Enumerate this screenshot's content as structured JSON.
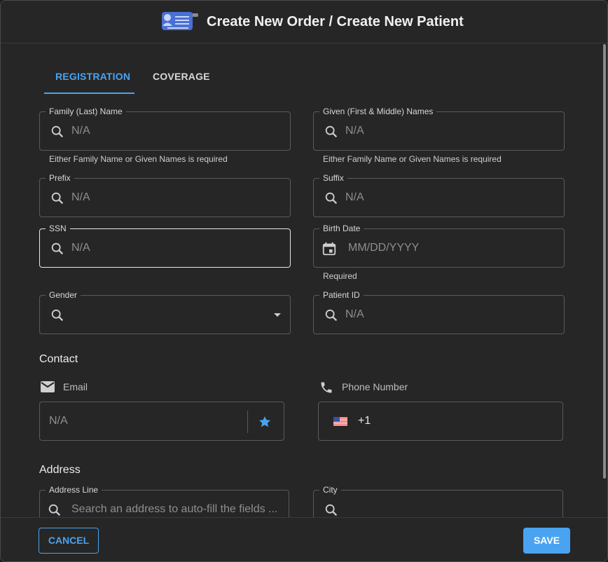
{
  "header": {
    "title": "Create New Order / Create New Patient",
    "logo_icon": "patient-card-icon"
  },
  "tabs": [
    {
      "label": "REGISTRATION",
      "active": true
    },
    {
      "label": "COVERAGE",
      "active": false
    }
  ],
  "fields": {
    "family_name": {
      "label": "Family (Last) Name",
      "placeholder": "N/A",
      "helper": "Either Family Name or Given Names is required"
    },
    "given_names": {
      "label": "Given (First & Middle) Names",
      "placeholder": "N/A",
      "helper": "Either Family Name or Given Names is required"
    },
    "prefix": {
      "label": "Prefix",
      "placeholder": "N/A"
    },
    "suffix": {
      "label": "Suffix",
      "placeholder": "N/A"
    },
    "ssn": {
      "label": "SSN",
      "placeholder": "N/A"
    },
    "birth_date": {
      "label": "Birth Date",
      "placeholder": "MM/DD/YYYY",
      "helper": "Required"
    },
    "gender": {
      "label": "Gender",
      "value": ""
    },
    "patient_id": {
      "label": "Patient ID",
      "placeholder": "N/A"
    }
  },
  "contact": {
    "heading": "Contact",
    "email": {
      "label": "Email",
      "placeholder": "N/A"
    },
    "phone": {
      "label": "Phone Number",
      "country_code": "+1"
    }
  },
  "address": {
    "heading": "Address",
    "address_line": {
      "label": "Address Line",
      "placeholder": "Search an address to auto-fill the fields ..."
    },
    "city": {
      "label": "City",
      "placeholder": ""
    }
  },
  "footer": {
    "cancel_label": "CANCEL",
    "save_label": "SAVE"
  },
  "colors": {
    "accent": "#4aa3f0",
    "background": "#262626",
    "border": "#5a5a5a"
  }
}
